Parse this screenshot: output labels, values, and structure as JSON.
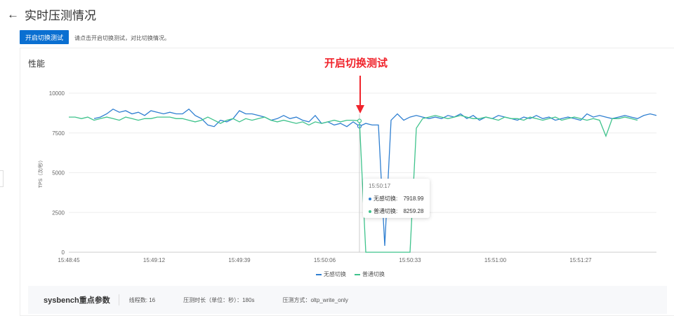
{
  "header": {
    "title": "实时压测情况",
    "back_icon": "arrow-left-icon"
  },
  "toolbar": {
    "start_button": "开启切换测试",
    "hint": "请点击开启切换测试，对比切换情况。"
  },
  "card": {
    "title": "性能"
  },
  "annotation": "开启切换测试",
  "tooltip": {
    "time": "15:50:17",
    "rows": [
      {
        "label": "无感切换:",
        "value": "7918.99"
      },
      {
        "label": "普通切换:",
        "value": "8259.28"
      }
    ]
  },
  "params": {
    "title": "sysbench重点参数",
    "threads": "线程数: 16",
    "duration": "压测时长（单位：秒）：180s",
    "mode": "压测方式：oltp_write_only"
  },
  "chart_data": {
    "type": "line",
    "ylabel": "TPS（次/秒）",
    "ylim": [
      0,
      10000
    ],
    "yticks": [
      0,
      2500,
      5000,
      7500,
      10000
    ],
    "xlim_seconds": [
      0,
      186
    ],
    "xticks": [
      {
        "t": 0,
        "label": "15:48:45"
      },
      {
        "t": 27,
        "label": "15:49:12"
      },
      {
        "t": 54,
        "label": "15:49:39"
      },
      {
        "t": 81,
        "label": "15:50:06"
      },
      {
        "t": 108,
        "label": "15:50:33"
      },
      {
        "t": 135,
        "label": "15:51:00"
      },
      {
        "t": 162,
        "label": "15:51:27"
      }
    ],
    "x_step_seconds": 2,
    "series": [
      {
        "name": "无感切换",
        "color": "#2f7fd1",
        "values": [
          null,
          null,
          null,
          null,
          8400,
          8500,
          8700,
          9000,
          8800,
          8900,
          8700,
          8800,
          8600,
          8900,
          8800,
          8700,
          8800,
          8700,
          8700,
          9000,
          8600,
          8400,
          8000,
          7900,
          8300,
          8200,
          8400,
          8900,
          8700,
          8700,
          8600,
          8500,
          8300,
          8400,
          8600,
          8400,
          8500,
          8300,
          8200,
          8600,
          8100,
          8200,
          8000,
          8100,
          7900,
          8200,
          7919,
          8100,
          8000,
          8000,
          400,
          8300,
          8700,
          8300,
          8500,
          8600,
          8500,
          8400,
          8500,
          8400,
          8600,
          8500,
          8700,
          8400,
          8600,
          8300,
          8500,
          8400,
          8600,
          8500,
          8400,
          8300,
          8500,
          8400,
          8600,
          8400,
          8500,
          8300,
          8400,
          8500,
          8400,
          8300,
          8700,
          8500,
          8600,
          8500,
          8400,
          8500,
          8600,
          8500,
          8400,
          8600,
          8700,
          8600
        ]
      },
      {
        "name": "普通切换",
        "color": "#3fc38c",
        "values": [
          8500,
          8500,
          8400,
          8500,
          8300,
          8400,
          8500,
          8400,
          8300,
          8500,
          8400,
          8300,
          8400,
          8400,
          8500,
          8500,
          8500,
          8400,
          8400,
          8300,
          8200,
          8300,
          8500,
          8300,
          8100,
          8300,
          8400,
          8200,
          8400,
          8300,
          8400,
          8500,
          8300,
          8200,
          8300,
          8200,
          8100,
          8200,
          8000,
          8200,
          8100,
          8200,
          8300,
          8200,
          8300,
          8300,
          8259,
          0,
          0,
          0,
          0,
          0,
          0,
          0,
          0,
          7800,
          8400,
          8500,
          8600,
          8500,
          8400,
          8500,
          8600,
          8500,
          8400,
          8400,
          8500,
          8400,
          8300,
          8500,
          8400,
          8400,
          8300,
          8500,
          8400,
          8300,
          8400,
          8500,
          8300,
          8400,
          8500,
          8400,
          8300,
          8400,
          8300,
          7300,
          8400,
          8400,
          8500,
          8400,
          8300,
          null,
          null,
          null
        ]
      }
    ],
    "tooltip_t": 92,
    "legend": "bottom"
  }
}
